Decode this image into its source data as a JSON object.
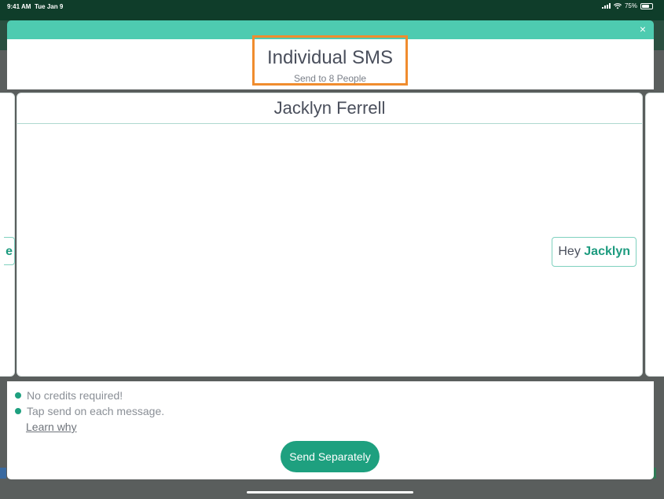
{
  "status_bar": {
    "time": "9:41 AM",
    "date": "Tue Jan 9",
    "battery": "75%"
  },
  "modal": {
    "close_glyph": "×",
    "title": "Individual SMS",
    "subtitle": "Send to 8 People"
  },
  "carousel": {
    "current_recipient": "Jacklyn Ferrell",
    "message_greeting": "Hey",
    "message_name": "Jacklyn",
    "left_peek_char": "e"
  },
  "footer": {
    "info_items": [
      "No credits required!",
      "Tap send on each message."
    ],
    "learn_link": "Learn why",
    "send_button": "Send Separately"
  },
  "colors": {
    "accent": "#1ea07f",
    "header_bar": "#4ecbb0",
    "highlight_border": "#f08c2e",
    "status_bar": "#0f3d2a"
  },
  "icons": [
    "signal-icon",
    "wifi-icon",
    "battery-icon",
    "close-icon",
    "bullet-dot-icon"
  ]
}
